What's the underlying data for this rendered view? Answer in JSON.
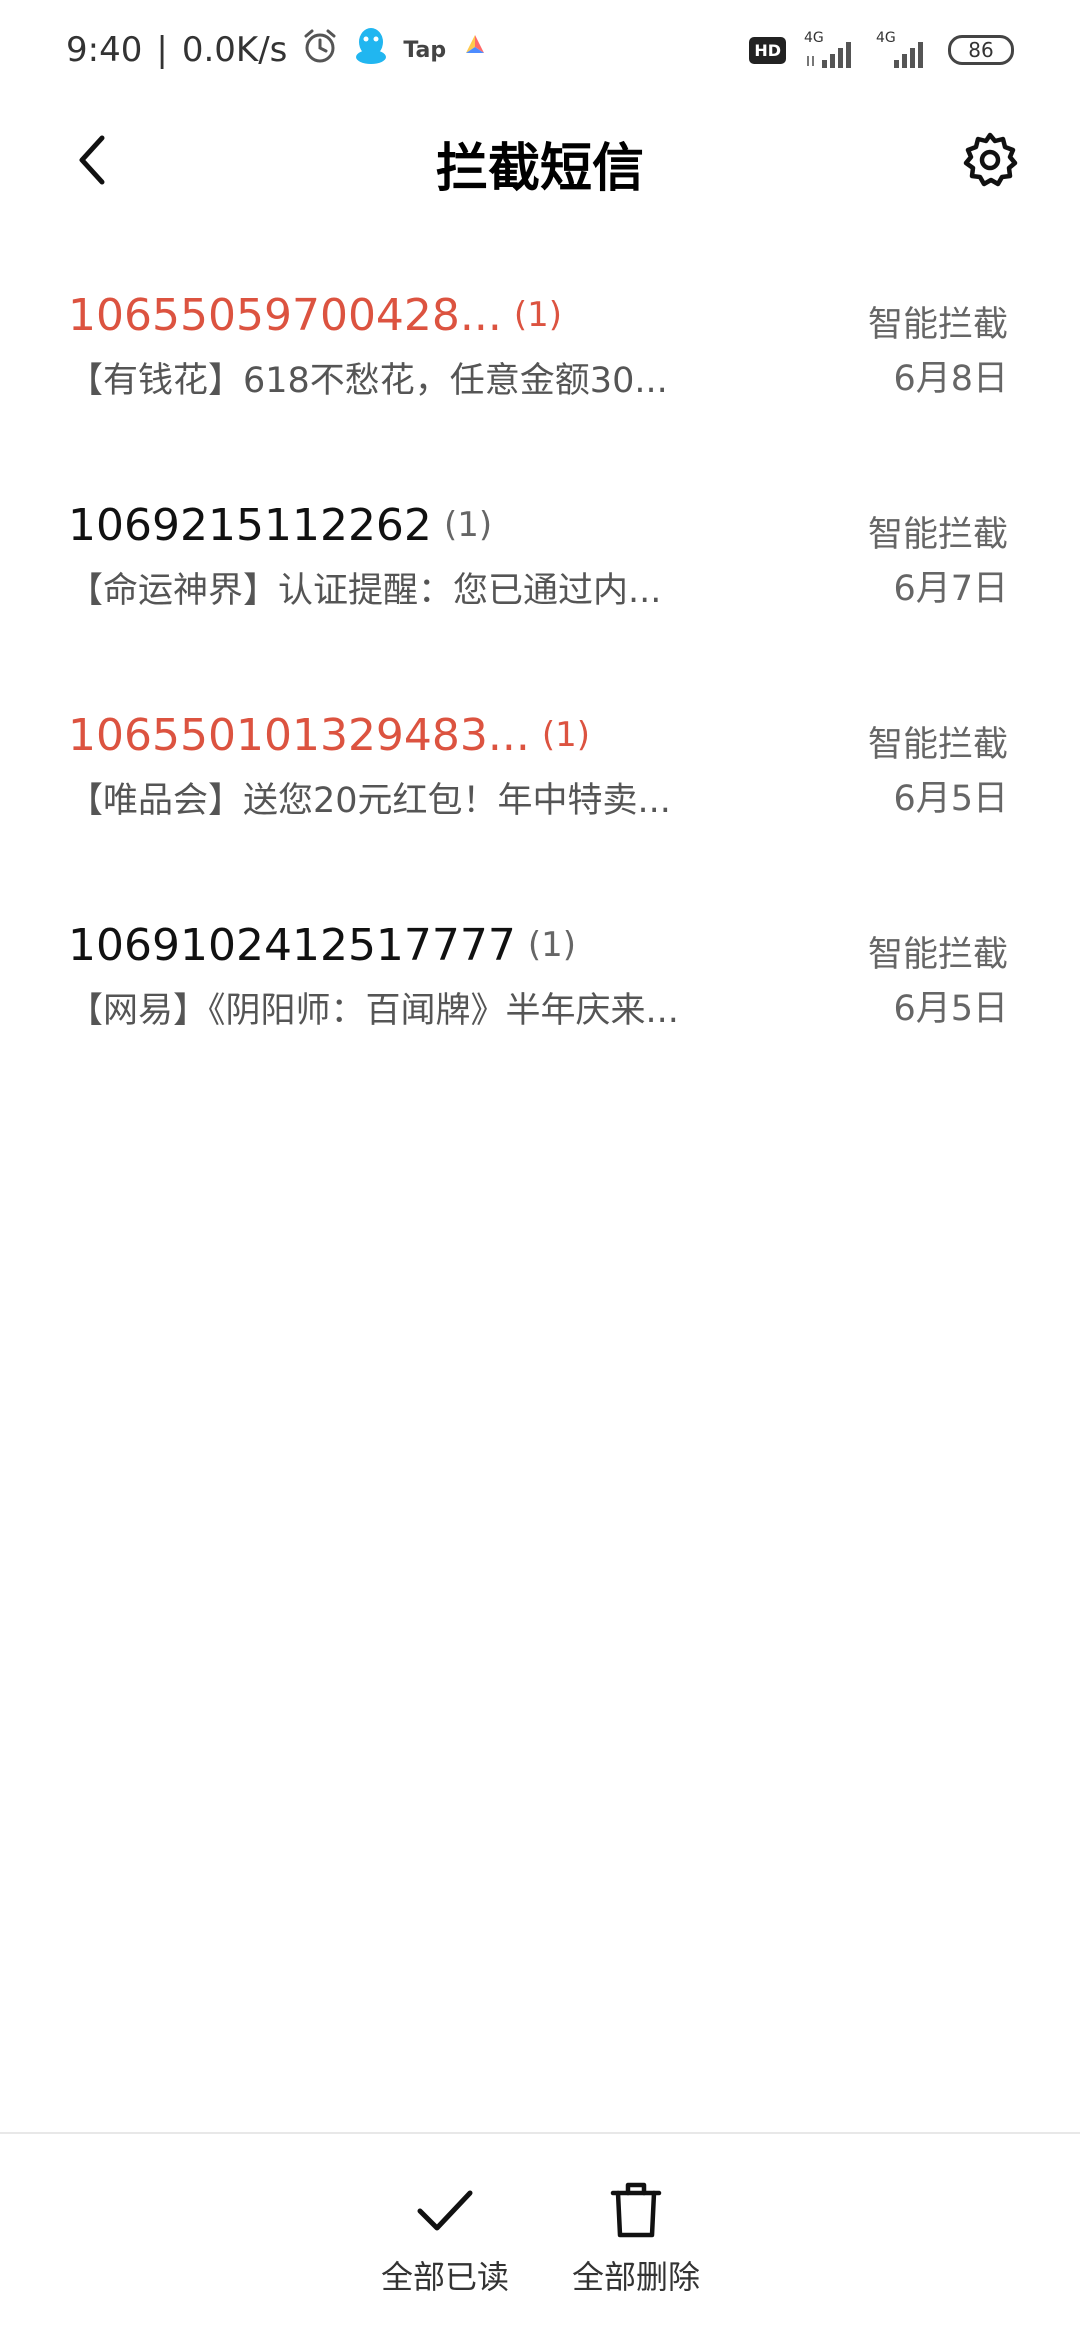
{
  "status_bar": {
    "time": "9:40",
    "separator": "|",
    "speed": "0.0K/s",
    "tap_label": "Tap",
    "hd_label": "HD",
    "net1": "4G",
    "net2": "4G",
    "battery": "86"
  },
  "header": {
    "title": "拦截短信"
  },
  "messages": [
    {
      "sender": "10655059700428...",
      "count": "(1)",
      "preview": "【有钱花】618不愁花，任意金额30...",
      "tag": "智能拦截",
      "date": "6月8日"
    },
    {
      "sender": "1069215112262",
      "count": "(1)",
      "preview": "【命运神界】认证提醒：您已通过内...",
      "tag": "智能拦截",
      "date": "6月7日"
    },
    {
      "sender": "106550101329483...",
      "count": "(1)",
      "preview": "【唯品会】送您20元红包！年中特卖...",
      "tag": "智能拦截",
      "date": "6月5日"
    },
    {
      "sender": "1069102412517777",
      "count": "(1)",
      "preview": "【网易】《阴阳师：百闻牌》半年庆来...",
      "tag": "智能拦截",
      "date": "6月5日"
    }
  ],
  "toolbar": {
    "mark_all_read": "全部已读",
    "delete_all": "全部删除"
  },
  "colors": {
    "unread_red": "#dc5340",
    "text_black": "#111111",
    "text_gray": "#666666"
  }
}
